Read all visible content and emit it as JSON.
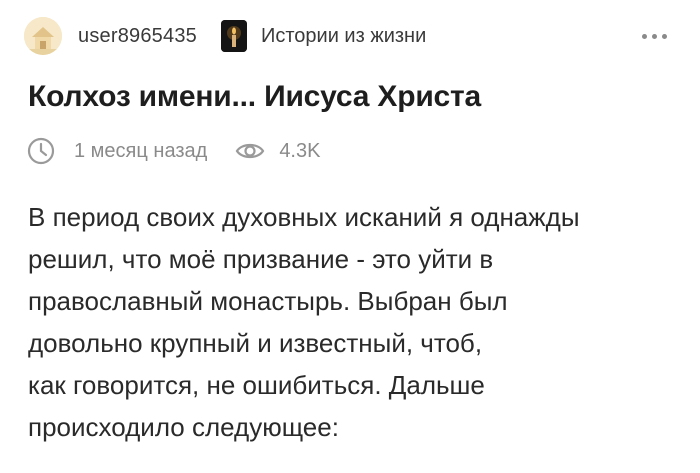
{
  "header": {
    "username": "user8965435",
    "community": "Истории из жизни",
    "more_icon": "more-horizontal-icon"
  },
  "post": {
    "title": "Колхоз имени... Иисуса Христа",
    "time": "1 месяц назад",
    "views": "4.3K",
    "lines": [
      "В период своих духовных исканий я однажды",
      "решил, что моё призвание - это уйти в",
      "православный монастырь. Выбран был",
      "довольно крупный и известный, чтоб,",
      "как говорится, не ошибиться. Дальше",
      "происходило следующее:"
    ]
  }
}
